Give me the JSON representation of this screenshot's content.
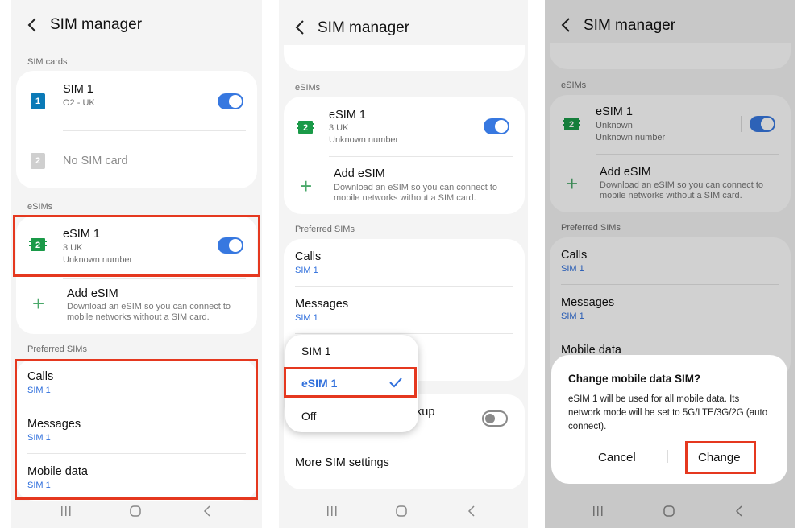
{
  "common": {
    "screen_title": "SIM manager",
    "esims_header": "eSIMs",
    "esim_name": "eSIM 1",
    "add_esim_title": "Add eSIM",
    "add_esim_desc": "Download an eSIM so you can connect to mobile networks without a SIM card.",
    "preferred_header": "Preferred SIMs",
    "calls": "Calls",
    "messages": "Messages",
    "mobile_data": "Mobile data",
    "sim1": "SIM 1",
    "esim_badge": "2"
  },
  "panel1": {
    "sim_cards_header": "SIM cards",
    "sim1_name": "SIM 1",
    "sim1_carrier": "O2 - UK",
    "sim1_badge": "1",
    "sim2_badge": "2",
    "no_sim": "No SIM card",
    "esim_carrier": "3 UK",
    "esim_number": "Unknown number",
    "calls_value": "SIM 1",
    "messages_value": "SIM 1",
    "mobile_data_value": "SIM 1"
  },
  "panel2": {
    "esim_carrier": "3 UK",
    "esim_number": "Unknown number",
    "calls_value": "SIM 1",
    "messages_value": "SIM 1",
    "menu": [
      {
        "label": "SIM 1",
        "selected": false
      },
      {
        "label": "eSIM 1",
        "selected": true
      },
      {
        "label": "Off",
        "selected": false
      }
    ],
    "partial_text": "kup",
    "more_settings": "More SIM settings"
  },
  "panel3": {
    "esim_status": "Unknown",
    "esim_number": "Unknown number",
    "calls_value": "SIM 1",
    "messages_value": "SIM 1",
    "dialog": {
      "title": "Change mobile data SIM?",
      "body": "eSIM 1 will be used for all mobile data. Its network mode will be set to 5G/LTE/3G/2G (auto connect).",
      "cancel": "Cancel",
      "confirm": "Change"
    }
  },
  "colors": {
    "accent": "#3778e0",
    "highlight": "#e5381f",
    "esim_green": "#1a9a48",
    "sim1_blue": "#0b7ab7"
  }
}
